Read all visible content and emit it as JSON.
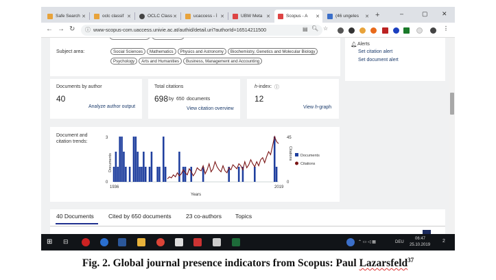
{
  "browser": {
    "tabs": [
      {
        "label": "Safe Search",
        "color": "#e8a33b"
      },
      {
        "label": "oclc classif",
        "color": "#e8a33b"
      },
      {
        "label": "OCLC Class",
        "color": "#444444"
      },
      {
        "label": "ucaccess - İ",
        "color": "#e8a33b"
      },
      {
        "label": "UBW Meta",
        "color": "#d44"
      },
      {
        "label": "Scopus - A",
        "color": "#d44",
        "active": true
      },
      {
        "label": "(46 ungeles",
        "color": "#3b6fc9"
      }
    ],
    "new_tab": "+",
    "window_controls": {
      "minimize": "–",
      "restore": "▢",
      "close": "✕"
    },
    "nav": {
      "back": "←",
      "forward": "→",
      "reload": "↻"
    },
    "url": "www-scopus-com.uaccess.univie.ac.at/authid/detail.uri?authorId=16514211500"
  },
  "profile": {
    "subject_area_label": "Subject area:",
    "subject_chips_row1": [
      "Social Sciences",
      "Mathematics",
      "Physics and Astronomy",
      "Biochemistry, Genetics and Molecular Biology"
    ],
    "subject_chips_row2": [
      "Psychology",
      "Arts and Humanities",
      "Business, Management and Accounting"
    ],
    "alerts": {
      "title": "Alerts",
      "citation": "Set citation alert",
      "document": "Set document alert"
    },
    "documents": {
      "label": "Documents by author",
      "value": "40",
      "link": "Analyze author output"
    },
    "citations": {
      "label": "Total citations",
      "value": "698",
      "by": "by",
      "docs_value": "650",
      "docs_label": "documents",
      "link": "View citation overview"
    },
    "hindex": {
      "label_prefix": "h",
      "label_suffix": "-index:",
      "value": "12",
      "link_prefix": "View ",
      "link_h": "h",
      "link_suffix": "-graph"
    },
    "trends_label_1": "Document and",
    "trends_label_2": "citation trends:",
    "tabs": [
      "40 Documents",
      "Cited by 650 documents",
      "23 co-authors",
      "Topics"
    ]
  },
  "chart_data": {
    "type": "bar",
    "xlabel": "Years",
    "ylabel_left": "Documents",
    "ylabel_right": "Citations",
    "xlim": [
      1936,
      2019
    ],
    "ylim_left": [
      0,
      3
    ],
    "ylim_right": [
      0,
      45
    ],
    "x_ticks": [
      "1936",
      "2019"
    ],
    "left_ticks": [
      "3",
      "0"
    ],
    "right_ticks": [
      "45",
      "0"
    ],
    "series": [
      {
        "name": "Documents",
        "type": "bar",
        "color": "#1f3f9e",
        "years": [
          1936,
          1937,
          1938,
          1939,
          1940,
          1941,
          1942,
          1944,
          1946,
          1947,
          1948,
          1949,
          1950,
          1951,
          1952,
          1954,
          1955,
          1958,
          1959,
          1961,
          1962,
          1969,
          1971,
          1972,
          1975,
          1981,
          1994,
          1999,
          2001,
          2007,
          2017,
          2018
        ],
        "values": [
          1,
          2,
          1,
          3,
          3,
          2,
          1,
          1,
          3,
          3,
          2,
          1,
          1,
          2,
          1,
          1,
          2,
          1,
          1,
          3,
          1,
          2,
          1,
          1,
          1,
          1,
          1,
          1,
          1,
          1,
          3,
          1
        ]
      },
      {
        "name": "Citations",
        "type": "line",
        "color": "#7a1515",
        "years": [
          1963,
          1964,
          1965,
          1966,
          1967,
          1968,
          1969,
          1970,
          1971,
          1972,
          1973,
          1974,
          1975,
          1976,
          1977,
          1978,
          1979,
          1980,
          1981,
          1982,
          1983,
          1984,
          1985,
          1986,
          1987,
          1988,
          1989,
          1990,
          1991,
          1992,
          1993,
          1994,
          1995,
          1996,
          1997,
          1998,
          1999,
          2000,
          2001,
          2002,
          2003,
          2004,
          2005,
          2006,
          2007,
          2008,
          2009,
          2010,
          2011,
          2012,
          2013,
          2014,
          2015,
          2016,
          2017,
          2018,
          2019
        ],
        "values": [
          3,
          5,
          4,
          7,
          5,
          9,
          6,
          8,
          12,
          9,
          7,
          13,
          10,
          6,
          9,
          14,
          12,
          11,
          16,
          8,
          12,
          18,
          10,
          13,
          20,
          15,
          12,
          10,
          16,
          11,
          9,
          14,
          12,
          17,
          15,
          13,
          18,
          16,
          12,
          20,
          14,
          17,
          22,
          18,
          15,
          20,
          16,
          22,
          24,
          19,
          25,
          30,
          27,
          36,
          45,
          40,
          38
        ]
      }
    ],
    "legend": [
      "Documents",
      "Citations"
    ],
    "legend_position": "right"
  },
  "taskbar": {
    "lang": "DEU",
    "time": "06:47",
    "date": "25.10.2019",
    "notif": "2"
  },
  "caption": {
    "text": "Fig. 2. Global journal presence indicators from Scopus: Paul ",
    "name": "Lazarsfeld",
    "sup": "37"
  }
}
